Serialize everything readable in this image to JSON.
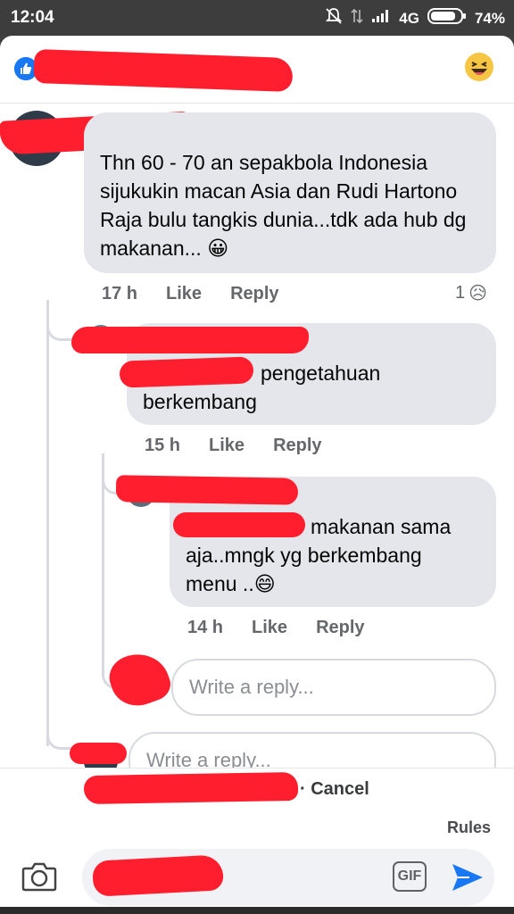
{
  "status_bar": {
    "time": "12:04",
    "network": "4G",
    "battery": "74%"
  },
  "header": {
    "like_icon": "thumbs-up-icon",
    "reaction_icon": "haha-emoji-icon"
  },
  "comments": [
    {
      "text": "Thn 60 - 70 an sepakbola Indonesia sijukukin macan Asia dan Rudi Hartono Raja bulu tangkis dunia...tdk ada hub dg makanan...",
      "emoji": "😀",
      "time": "17 h",
      "like": "Like",
      "reply": "Reply",
      "reaction_count": "1",
      "reaction_emoji": "😥"
    },
    {
      "text_line1": "pengetahuan",
      "text_line2": "berkembang",
      "time": "15 h",
      "like": "Like",
      "reply": "Reply"
    },
    {
      "text_line1": "makanan sama",
      "text_line2": "aja..mngk yg berkembang",
      "text_line3": "menu ..",
      "emoji": "😄",
      "time": "14 h",
      "like": "Like",
      "reply": "Reply"
    }
  ],
  "reply_inputs": {
    "nested_placeholder": "Write a reply...",
    "outer_placeholder": "Write a reply..."
  },
  "bottom": {
    "cancel": "· Cancel",
    "rules": "Rules"
  },
  "composer": {
    "gif_label": "GIF"
  },
  "colors": {
    "accent": "#1877f2",
    "bubble": "#e4e6eb",
    "redaction": "#ff1e2d"
  }
}
